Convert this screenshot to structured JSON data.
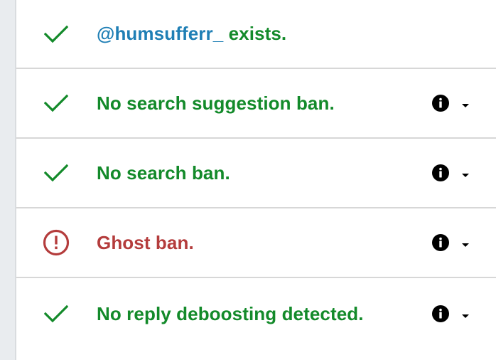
{
  "results": {
    "exists": {
      "handle": "@humsufferr_",
      "suffix": " exists.",
      "status": "ok",
      "icon": "check-icon"
    },
    "items": [
      {
        "label": "No search suggestion ban.",
        "status": "ok",
        "icon": "check-icon"
      },
      {
        "label": "No search ban.",
        "status": "ok",
        "icon": "check-icon"
      },
      {
        "label": "Ghost ban.",
        "status": "warning",
        "icon": "alert-circle-icon"
      },
      {
        "label": "No reply deboosting detected.",
        "status": "ok",
        "icon": "check-icon"
      }
    ]
  },
  "colors": {
    "ok": "#138a2a",
    "warning": "#b43c3c",
    "handle": "#1f7fb5"
  }
}
